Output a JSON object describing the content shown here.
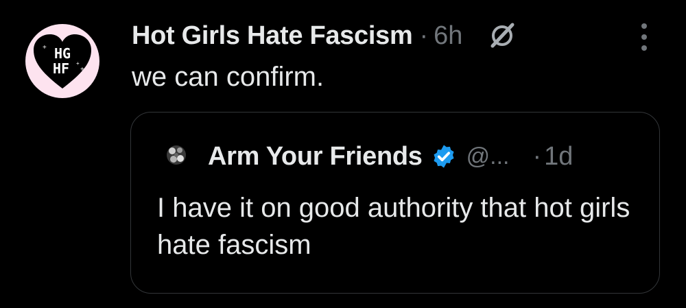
{
  "post": {
    "author_name": "Hot Girls Hate Fascism",
    "separator": "·",
    "time": "6h",
    "text": "we can confirm.",
    "avatar_text": "HG HF",
    "icons": [
      "heart-logo-avatar",
      "grok-icon",
      "more-icon"
    ]
  },
  "quote": {
    "author_name": "Arm Your Friends",
    "handle": "@...",
    "separator": "·",
    "time": "1d",
    "text": "I have it on good authority that hot girls hate fascism",
    "icons": [
      "avatar",
      "verified-badge-icon"
    ]
  },
  "colors": {
    "background": "#000000",
    "primary_text": "#e7e9ea",
    "secondary_text": "#71767b",
    "verified_blue": "#1d9bf0",
    "avatar_bg": "#fde3ef",
    "border": "#333639"
  }
}
